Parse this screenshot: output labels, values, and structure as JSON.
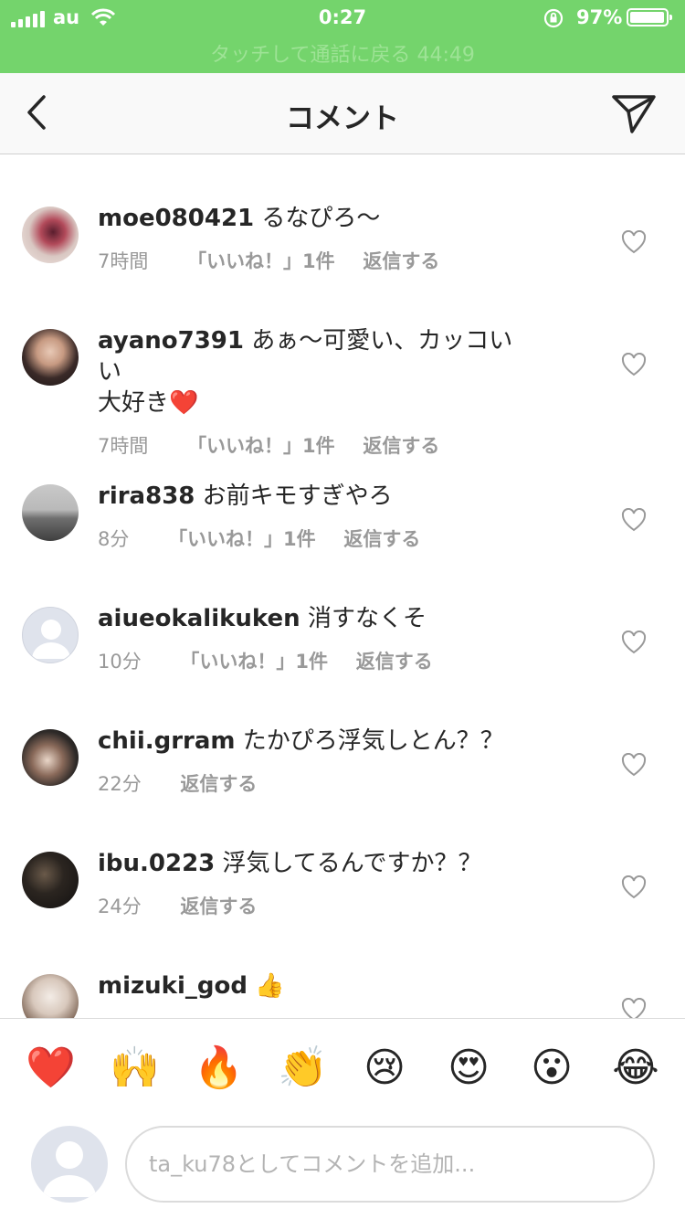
{
  "status": {
    "carrier": "au",
    "time": "0:27",
    "battery": "97%",
    "battery_level": 0.97,
    "call_banner": "タッチして通話に戻る 44:49"
  },
  "header": {
    "title": "コメント"
  },
  "comments": [
    {
      "username": "moe080421",
      "text": "るなぴろ〜",
      "time": "7時間",
      "likes": "「いいね！」1件",
      "reply": "返信する",
      "avatar": "photo"
    },
    {
      "username": "ayano7391",
      "text": "あぁ〜可愛い、カッコいい",
      "text2": "大好き❤️",
      "time": "7時間",
      "likes": "「いいね！」1件",
      "reply": "返信する",
      "avatar": "photo"
    },
    {
      "username": "rira838",
      "text": "お前キモすぎやろ",
      "time": "8分",
      "likes": "「いいね！」1件",
      "reply": "返信する",
      "avatar": "photo"
    },
    {
      "username": "aiueokalikuken",
      "text": "消すなくそ",
      "time": "10分",
      "likes": "「いいね！」1件",
      "reply": "返信する",
      "avatar": "default"
    },
    {
      "username": "chii.grram",
      "text": "たかぴろ浮気しとん？？",
      "time": "22分",
      "reply": "返信する",
      "avatar": "photo"
    },
    {
      "username": "ibu.0223",
      "text": "浮気してるんですか？？",
      "time": "24分",
      "reply": "返信する",
      "avatar": "photo"
    },
    {
      "username": "mizuki_god",
      "text": "👍",
      "avatar": "photo"
    }
  ],
  "emoji_bar": [
    "❤️",
    "🙌",
    "🔥",
    "👏",
    "😢",
    "😍",
    "😮",
    "😂"
  ],
  "input": {
    "placeholder": "ta_ku78としてコメントを追加..."
  },
  "colors": {
    "status_green": "#74d46c",
    "meta_gray": "#999999",
    "text_dark": "#262626"
  }
}
